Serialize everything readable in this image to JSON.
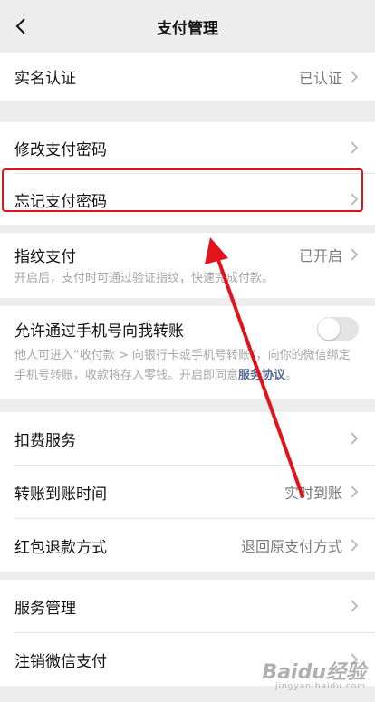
{
  "header": {
    "title": "支付管理",
    "back_icon": "chevron-left-icon"
  },
  "real_name": {
    "label": "实名认证",
    "value": "已认证"
  },
  "modify_password": {
    "label": "修改支付密码"
  },
  "forgot_password": {
    "label": "忘记支付密码"
  },
  "fingerprint": {
    "label": "指纹支付",
    "value": "已开启",
    "description": "开启后，支付时可通过验证指纹，快速完成付款。"
  },
  "phone_transfer": {
    "label": "允许通过手机号向我转账",
    "description": "他人可进入“收付款 > 向银行卡或手机号转账”，向你的微信绑定手机号转账，收款将存入零钱。开启即同意",
    "link": "服务协议",
    "suffix": "。",
    "toggle_on": false
  },
  "deduction_service": {
    "label": "扣费服务"
  },
  "transfer_time": {
    "label": "转账到账时间",
    "value": "实时到账"
  },
  "red_packet_refund": {
    "label": "红包退款方式",
    "value": "退回原支付方式"
  },
  "service_management": {
    "label": "服务管理"
  },
  "cancel_wechat_pay": {
    "label": "注销微信支付"
  },
  "watermark": {
    "brand": "Baidu经验",
    "url": "jingyan.baidu.com"
  },
  "colors": {
    "annotation_red": "#e0141a",
    "link_blue": "#576b95",
    "background": "#ededed"
  }
}
